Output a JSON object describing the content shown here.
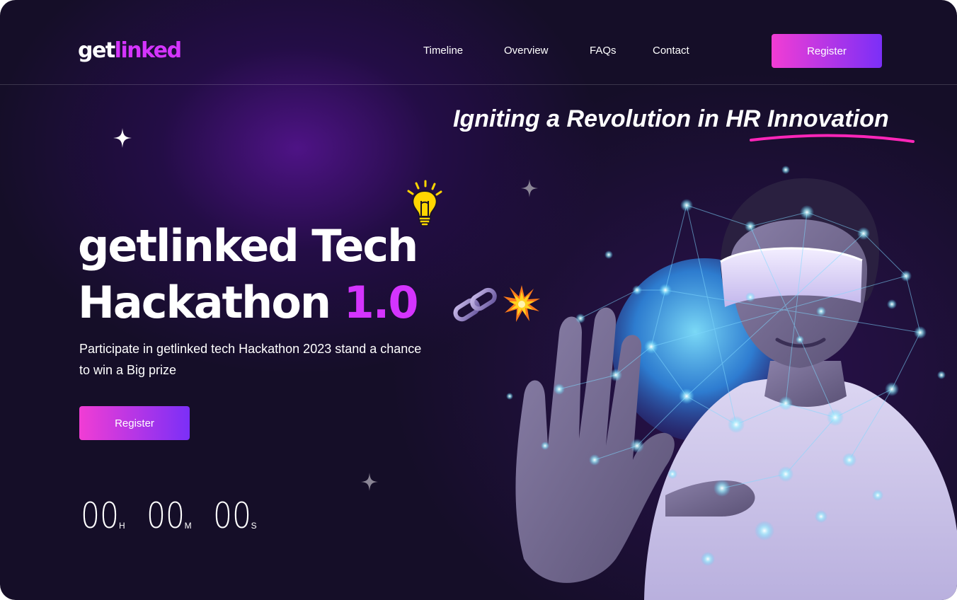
{
  "nav": {
    "logo_part1": "get",
    "logo_part2": "linked",
    "links": [
      "Timeline",
      "Overview",
      "FAQs",
      "Contact"
    ],
    "register_label": "Register"
  },
  "hero": {
    "tagline": "Igniting a Revolution in HR Innovation",
    "title_line1": "getlinked Tech",
    "title_line2_main": "Hackathon ",
    "title_line2_accent": "1.0",
    "description": "Participate in getlinked tech Hackathon 2023 stand a chance to win a Big prize",
    "register_label": "Register",
    "countdown": [
      {
        "value": "00",
        "unit": "H"
      },
      {
        "value": "00",
        "unit": "M"
      },
      {
        "value": "00",
        "unit": "S"
      }
    ],
    "icons": [
      "bulb-icon",
      "chain-icon",
      "burst-icon",
      "sparkle-star-icon"
    ]
  },
  "colors": {
    "background": "#150e28",
    "accent": "#d434fe",
    "button_gradient_start": "#f13dd4",
    "button_gradient_end": "#7b2ff7",
    "underline": "#ff26b9"
  }
}
